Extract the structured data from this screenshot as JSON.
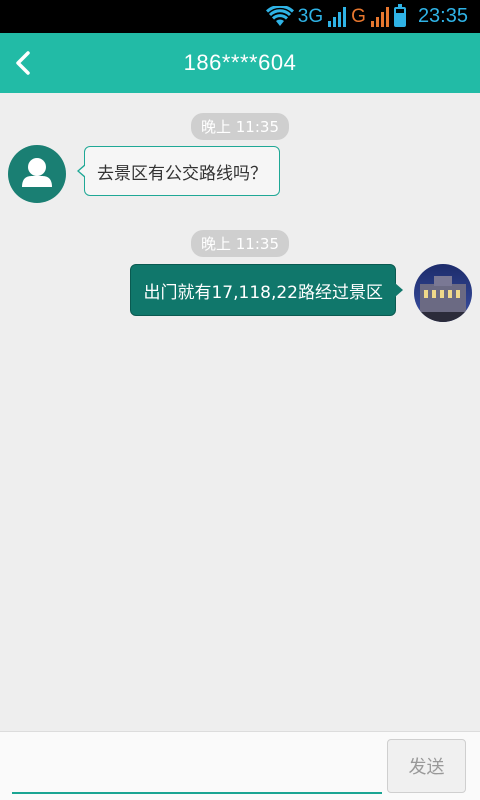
{
  "status_bar": {
    "network": "3G",
    "network2": "G",
    "time": "23:35"
  },
  "header": {
    "title": "186****604"
  },
  "messages": [
    {
      "timestamp": "晚上 11:35",
      "direction": "incoming",
      "text": "去景区有公交路线吗？"
    },
    {
      "timestamp": "晚上 11:35",
      "direction": "outgoing",
      "text": "出门就有17,118,22路经过景区"
    }
  ],
  "input": {
    "placeholder": "",
    "value": "",
    "send_label": "发送"
  },
  "colors": {
    "accent": "#22bba6",
    "outgoing_bubble": "#10776b",
    "status_icons": "#2fb3e6"
  }
}
